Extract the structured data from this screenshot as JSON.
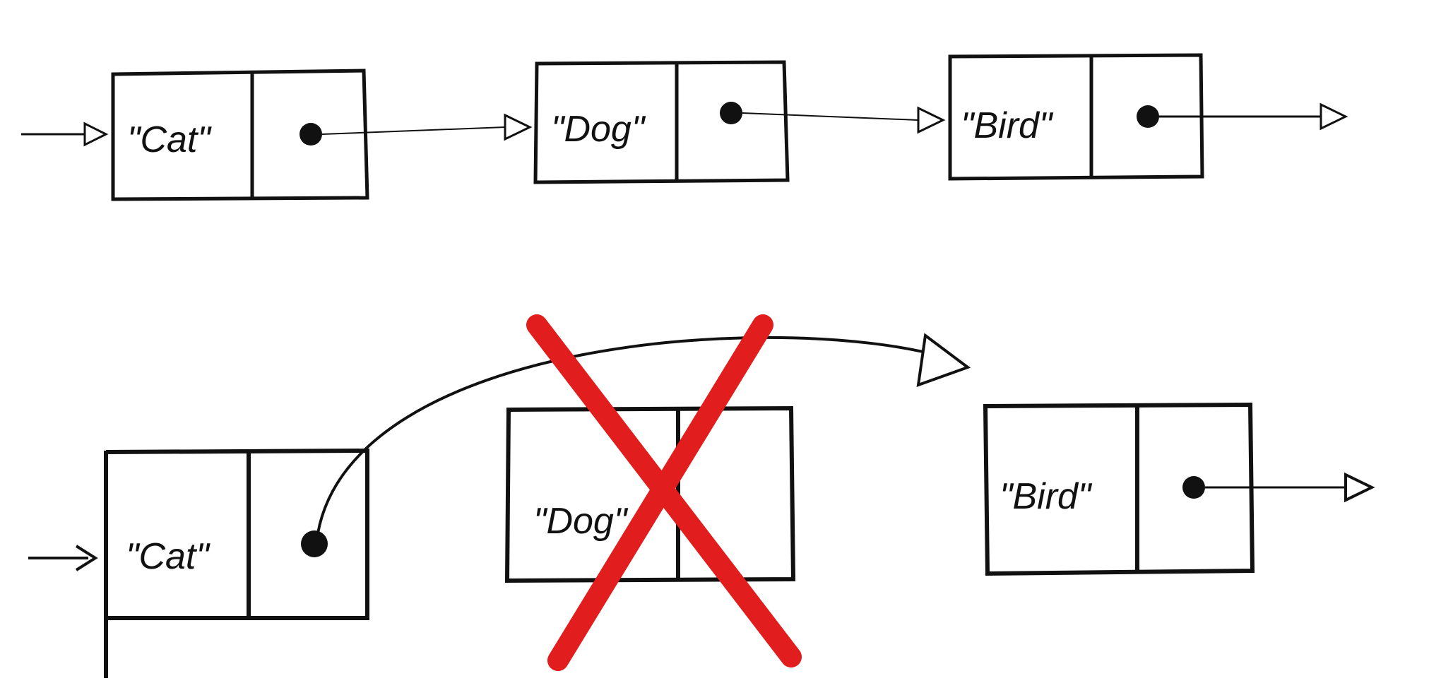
{
  "diagram": {
    "description": "Linked list node deletion illustration",
    "top_row": {
      "nodes": [
        {
          "label": "\"Cat\""
        },
        {
          "label": "\"Dog\""
        },
        {
          "label": "\"Bird\""
        }
      ]
    },
    "bottom_row": {
      "nodes": [
        {
          "label": "\"Cat\""
        },
        {
          "label": "\"Dog\"",
          "deleted": true
        },
        {
          "label": "\"Bird\""
        }
      ]
    },
    "colors": {
      "stroke": "#111111",
      "delete_mark": "#e11d1d"
    }
  }
}
